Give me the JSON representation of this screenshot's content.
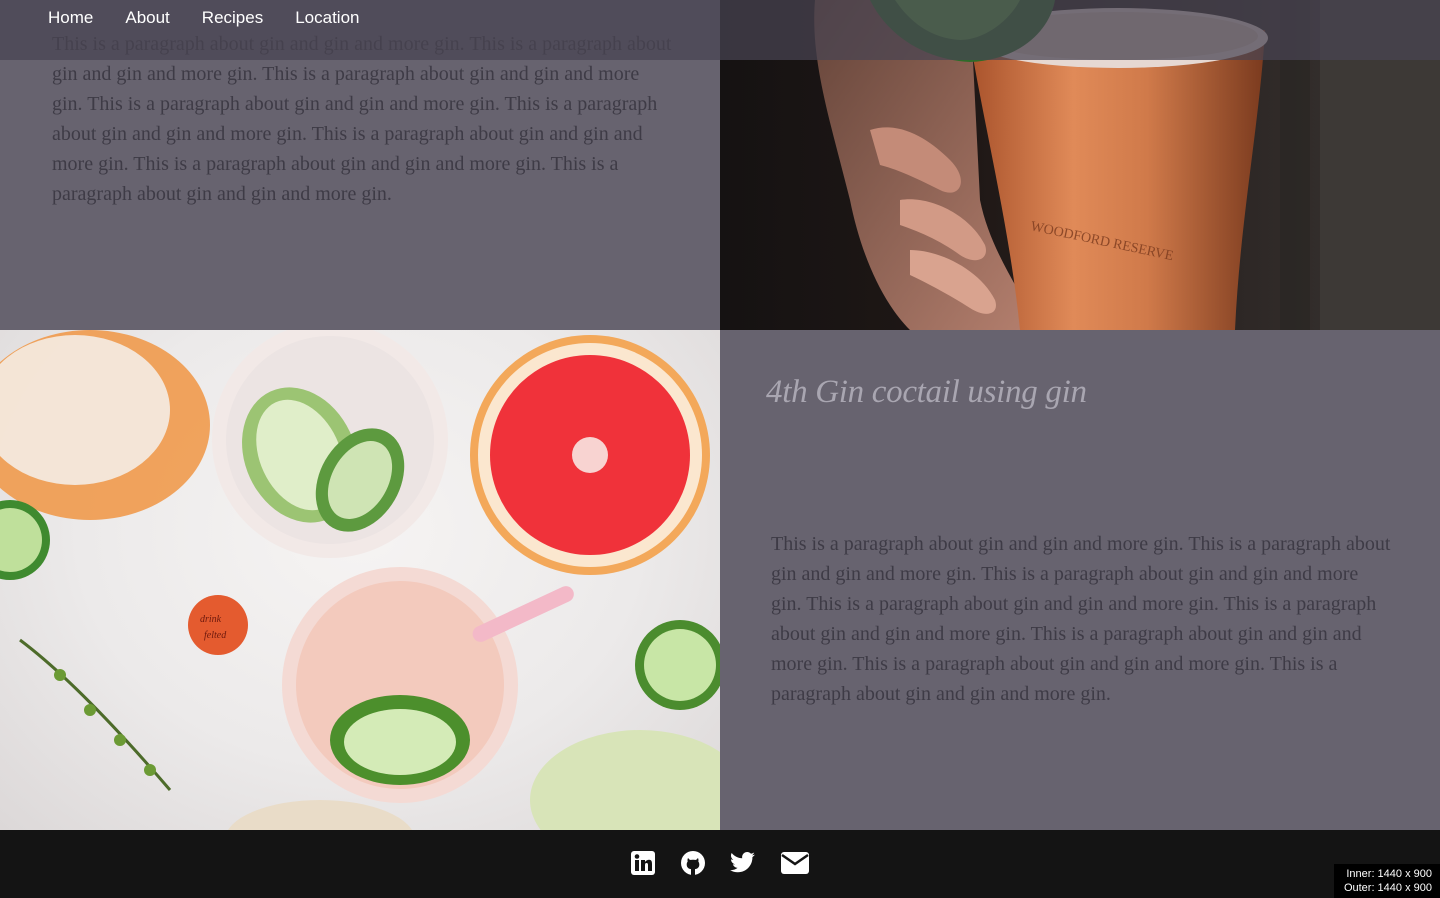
{
  "nav": {
    "items": [
      {
        "label": "Home"
      },
      {
        "label": "About"
      },
      {
        "label": "Recipes"
      },
      {
        "label": "Location"
      }
    ]
  },
  "section_top": {
    "paragraph": "This is a paragraph about gin and gin and more gin. This is a paragraph about gin and gin and more gin. This is a paragraph about gin and gin and more gin. This is a paragraph about gin and gin and more gin. This is a paragraph about gin and gin and more gin. This is a paragraph about gin and gin and more gin. This is a paragraph about gin and gin and more gin. This is a paragraph about gin and gin and more gin."
  },
  "section_bottom": {
    "heading": "4th Gin coctail using gin",
    "paragraph": "This is a paragraph about gin and gin and more gin. This is a paragraph about gin and gin and more gin. This is a paragraph about gin and gin and more gin. This is a paragraph about gin and gin and more gin. This is a paragraph about gin and gin and more gin. This is a paragraph about gin and gin and more gin. This is a paragraph about gin and gin and more gin. This is a paragraph about gin and gin and more gin."
  },
  "footer": {
    "icons": [
      "linkedin-icon",
      "github-icon",
      "twitter-icon",
      "envelope-icon"
    ]
  },
  "viewport_overlay": {
    "inner": "Inner: 1440 x 900",
    "outer": "Outer: 1440 x 900"
  },
  "colors": {
    "panel": "#67636f",
    "text": "#3e3b46",
    "heading": "#a9a6b1",
    "footer": "#141414"
  }
}
